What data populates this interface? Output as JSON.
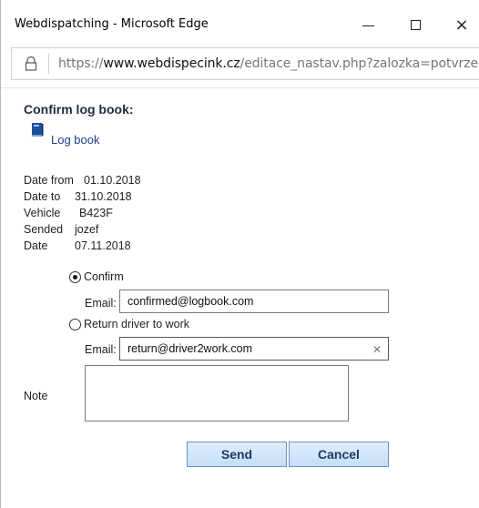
{
  "window": {
    "title": "Webdispatching - Microsoft Edge",
    "controls": {
      "minimize": "minimize",
      "maximize": "maximize",
      "close": "×"
    }
  },
  "address_bar": {
    "scheme": "https://",
    "domain": "www.webdispecink.cz",
    "path": "/editace_nastav.php?zalozka=potvrze"
  },
  "page": {
    "title": "Confirm log book:",
    "logbook_link": "Log book",
    "info": [
      {
        "key": "Date from",
        "value": "01.10.2018"
      },
      {
        "key": "Date to",
        "value": "31.10.2018"
      },
      {
        "key": "Vehicle",
        "value": "B423F"
      },
      {
        "key": "Sended",
        "value": "jozef"
      },
      {
        "key": "Date",
        "value": "07.11.2018"
      }
    ],
    "options": {
      "confirm_label": "Confirm",
      "confirm_selected": true,
      "confirm_email_label": "Email:",
      "confirm_email_value": "confirmed@logbook.com",
      "return_label": "Return driver to work",
      "return_selected": false,
      "return_email_label": "Email:",
      "return_email_value": "return@driver2work.com"
    },
    "note_label": "Note",
    "note_value": "",
    "buttons": {
      "send": "Send",
      "cancel": "Cancel"
    }
  },
  "icons": {
    "lock": "lock-icon",
    "book": "book-icon",
    "clear": "clear-icon"
  },
  "colors": {
    "button_bg": "#c3def8",
    "button_border": "#6f93c4",
    "link": "#1a3f8a"
  }
}
